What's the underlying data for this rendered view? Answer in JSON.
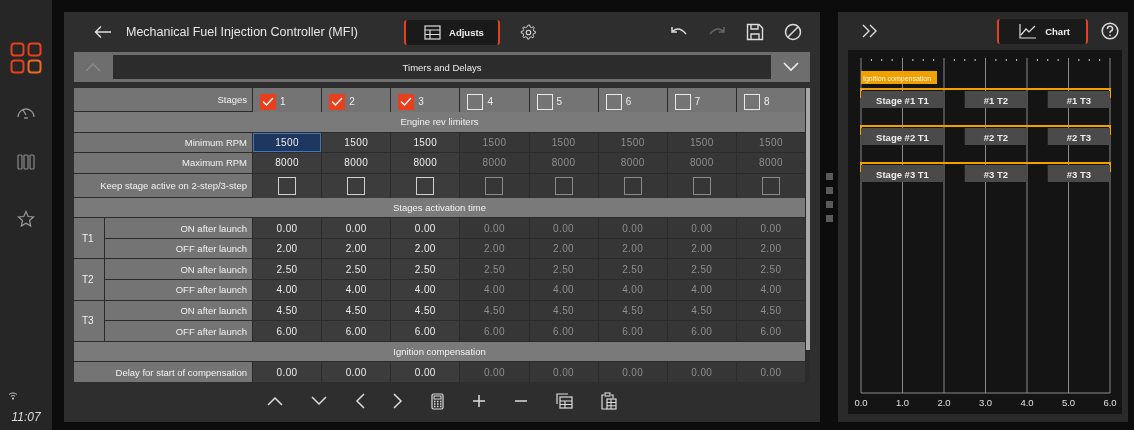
{
  "sidebar": {
    "time": "11:07"
  },
  "header": {
    "title": "Mechanical Fuel Injection Controller (MFI)",
    "tabs": [
      {
        "label": "Adjusts",
        "selected": true
      }
    ]
  },
  "section_bar": {
    "title": "Timers and Delays"
  },
  "table": {
    "stages_label": "Stages",
    "stages": [
      {
        "label": "1",
        "checked": true
      },
      {
        "label": "2",
        "checked": true
      },
      {
        "label": "3",
        "checked": true
      },
      {
        "label": "4",
        "checked": false
      },
      {
        "label": "5",
        "checked": false
      },
      {
        "label": "6",
        "checked": false
      },
      {
        "label": "7",
        "checked": false
      },
      {
        "label": "8",
        "checked": false
      }
    ],
    "sections": [
      {
        "title": "Engine rev limiters",
        "rows": [
          {
            "kind": "value",
            "label": "Minimum RPM",
            "cells": [
              {
                "text": "1500",
                "selected": true
              },
              {
                "text": "1500",
                "selected": false
              },
              {
                "text": "1500",
                "selected": false
              },
              {
                "text": "1500",
                "selected": false
              },
              {
                "text": "1500",
                "selected": false
              },
              {
                "text": "1500",
                "selected": false
              },
              {
                "text": "1500",
                "selected": false
              },
              {
                "text": "1500",
                "selected": false
              }
            ]
          },
          {
            "kind": "value",
            "label": "Maximum RPM",
            "cells": [
              {
                "text": "8000",
                "selected": false
              },
              {
                "text": "8000",
                "selected": false
              },
              {
                "text": "8000",
                "selected": false
              },
              {
                "text": "8000",
                "selected": false
              },
              {
                "text": "8000",
                "selected": false
              },
              {
                "text": "8000",
                "selected": false
              },
              {
                "text": "8000",
                "selected": false
              },
              {
                "text": "8000",
                "selected": false
              }
            ]
          },
          {
            "kind": "checkbox",
            "label": "Keep stage active on 2-step/3-step",
            "cells": [
              {
                "checked": false
              },
              {
                "checked": false
              },
              {
                "checked": false
              },
              {
                "checked": false
              },
              {
                "checked": false
              },
              {
                "checked": false
              },
              {
                "checked": false
              },
              {
                "checked": false
              }
            ]
          }
        ]
      },
      {
        "title": "Stages activation time",
        "groups": [
          {
            "name": "T1",
            "rows": [
              {
                "kind": "value",
                "label": "ON after launch",
                "cells": [
                  {
                    "text": "0.00",
                    "selected": false
                  },
                  {
                    "text": "0.00",
                    "selected": false
                  },
                  {
                    "text": "0.00",
                    "selected": false
                  },
                  {
                    "text": "0.00",
                    "selected": false
                  },
                  {
                    "text": "0.00",
                    "selected": false
                  },
                  {
                    "text": "0.00",
                    "selected": false
                  },
                  {
                    "text": "0.00",
                    "selected": false
                  },
                  {
                    "text": "0.00",
                    "selected": false
                  }
                ]
              },
              {
                "kind": "value",
                "label": "OFF after launch",
                "cells": [
                  {
                    "text": "2.00",
                    "selected": false
                  },
                  {
                    "text": "2.00",
                    "selected": false
                  },
                  {
                    "text": "2.00",
                    "selected": false
                  },
                  {
                    "text": "2.00",
                    "selected": false
                  },
                  {
                    "text": "2.00",
                    "selected": false
                  },
                  {
                    "text": "2.00",
                    "selected": false
                  },
                  {
                    "text": "2.00",
                    "selected": false
                  },
                  {
                    "text": "2.00",
                    "selected": false
                  }
                ]
              }
            ]
          },
          {
            "name": "T2",
            "rows": [
              {
                "kind": "value",
                "label": "ON after launch",
                "cells": [
                  {
                    "text": "2.50",
                    "selected": false
                  },
                  {
                    "text": "2.50",
                    "selected": false
                  },
                  {
                    "text": "2.50",
                    "selected": false
                  },
                  {
                    "text": "2.50",
                    "selected": false
                  },
                  {
                    "text": "2.50",
                    "selected": false
                  },
                  {
                    "text": "2.50",
                    "selected": false
                  },
                  {
                    "text": "2.50",
                    "selected": false
                  },
                  {
                    "text": "2.50",
                    "selected": false
                  }
                ]
              },
              {
                "kind": "value",
                "label": "OFF after launch",
                "cells": [
                  {
                    "text": "4.00",
                    "selected": false
                  },
                  {
                    "text": "4.00",
                    "selected": false
                  },
                  {
                    "text": "4.00",
                    "selected": false
                  },
                  {
                    "text": "4.00",
                    "selected": false
                  },
                  {
                    "text": "4.00",
                    "selected": false
                  },
                  {
                    "text": "4.00",
                    "selected": false
                  },
                  {
                    "text": "4.00",
                    "selected": false
                  },
                  {
                    "text": "4.00",
                    "selected": false
                  }
                ]
              }
            ]
          },
          {
            "name": "T3",
            "rows": [
              {
                "kind": "value",
                "label": "ON after launch",
                "cells": [
                  {
                    "text": "4.50",
                    "selected": false
                  },
                  {
                    "text": "4.50",
                    "selected": false
                  },
                  {
                    "text": "4.50",
                    "selected": false
                  },
                  {
                    "text": "4.50",
                    "selected": false
                  },
                  {
                    "text": "4.50",
                    "selected": false
                  },
                  {
                    "text": "4.50",
                    "selected": false
                  },
                  {
                    "text": "4.50",
                    "selected": false
                  },
                  {
                    "text": "4.50",
                    "selected": false
                  }
                ]
              },
              {
                "kind": "value",
                "label": "OFF after launch",
                "cells": [
                  {
                    "text": "6.00",
                    "selected": false
                  },
                  {
                    "text": "6.00",
                    "selected": false
                  },
                  {
                    "text": "6.00",
                    "selected": false
                  },
                  {
                    "text": "6.00",
                    "selected": false
                  },
                  {
                    "text": "6.00",
                    "selected": false
                  },
                  {
                    "text": "6.00",
                    "selected": false
                  },
                  {
                    "text": "6.00",
                    "selected": false
                  },
                  {
                    "text": "6.00",
                    "selected": false
                  }
                ]
              }
            ]
          }
        ]
      },
      {
        "title": "Ignition compensation",
        "rows": [
          {
            "kind": "value",
            "label": "Delay for start of compensation",
            "cells": [
              {
                "text": "0.00",
                "selected": false
              },
              {
                "text": "0.00",
                "selected": false
              },
              {
                "text": "0.00",
                "selected": false
              },
              {
                "text": "0.00",
                "selected": false
              },
              {
                "text": "0.00",
                "selected": false
              },
              {
                "text": "0.00",
                "selected": false
              },
              {
                "text": "0.00",
                "selected": false
              },
              {
                "text": "0.00",
                "selected": false
              }
            ]
          }
        ]
      }
    ]
  },
  "right_panel": {
    "tabs": [
      {
        "label": "Chart",
        "selected": true
      }
    ]
  },
  "timeline": {
    "legend": "Ignition compensation",
    "rows": [
      {
        "labels": [
          "Stage #1 T1",
          "#1 T2",
          "#1 T3"
        ]
      },
      {
        "labels": [
          "Stage #2 T1",
          "#2 T2",
          "#2 T3"
        ]
      },
      {
        "labels": [
          "Stage #3 T1",
          "#3 T2",
          "#3 T3"
        ]
      }
    ],
    "ticks": [
      "0.0",
      "1.0",
      "2.0",
      "3.0",
      "4.0",
      "5.0",
      "6.0"
    ]
  }
}
